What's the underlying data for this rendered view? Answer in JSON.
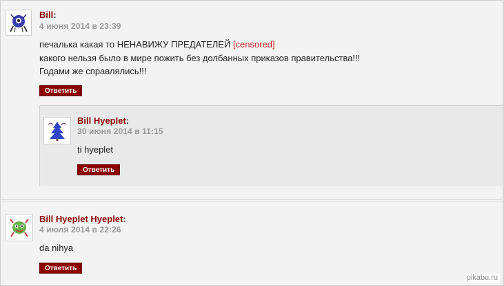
{
  "comments": [
    {
      "author": "Bill",
      "date": "4 июня 2014 в 23:39",
      "lines": [
        {
          "before": "печалька какая то НЕНАВИЖУ ПРЕДАТЕЛЕЙ ",
          "censored": "[censored]"
        },
        {
          "text": "какого нельзя было в мире пожить без долбанных приказов правительства!!!"
        },
        {
          "text": "Годами же справлялись!!!"
        }
      ],
      "reply_label": "Ответить",
      "avatar_icon": "blue-monster-avatar-icon"
    },
    {
      "author": "Bill Hyeplet",
      "date": "30 июня 2014 в 11:15",
      "text": "ti hyeplet",
      "reply_label": "Ответить",
      "avatar_icon": "blue-tree-avatar-icon"
    },
    {
      "author": "Bill Hyeplet Hyeplet",
      "date": "4 июля 2014 в 22:26",
      "text": "da nihya",
      "reply_label": "Ответить",
      "avatar_icon": "green-monster-avatar-icon"
    }
  ],
  "colon": ":",
  "watermark": "pikabu.ru",
  "colors": {
    "author": "#8b0000",
    "button": "#8b0000",
    "date": "#9a9a9a",
    "censored": "#cc2222",
    "background": "#f3f3f3",
    "nested_background": "#e9e9e9"
  }
}
